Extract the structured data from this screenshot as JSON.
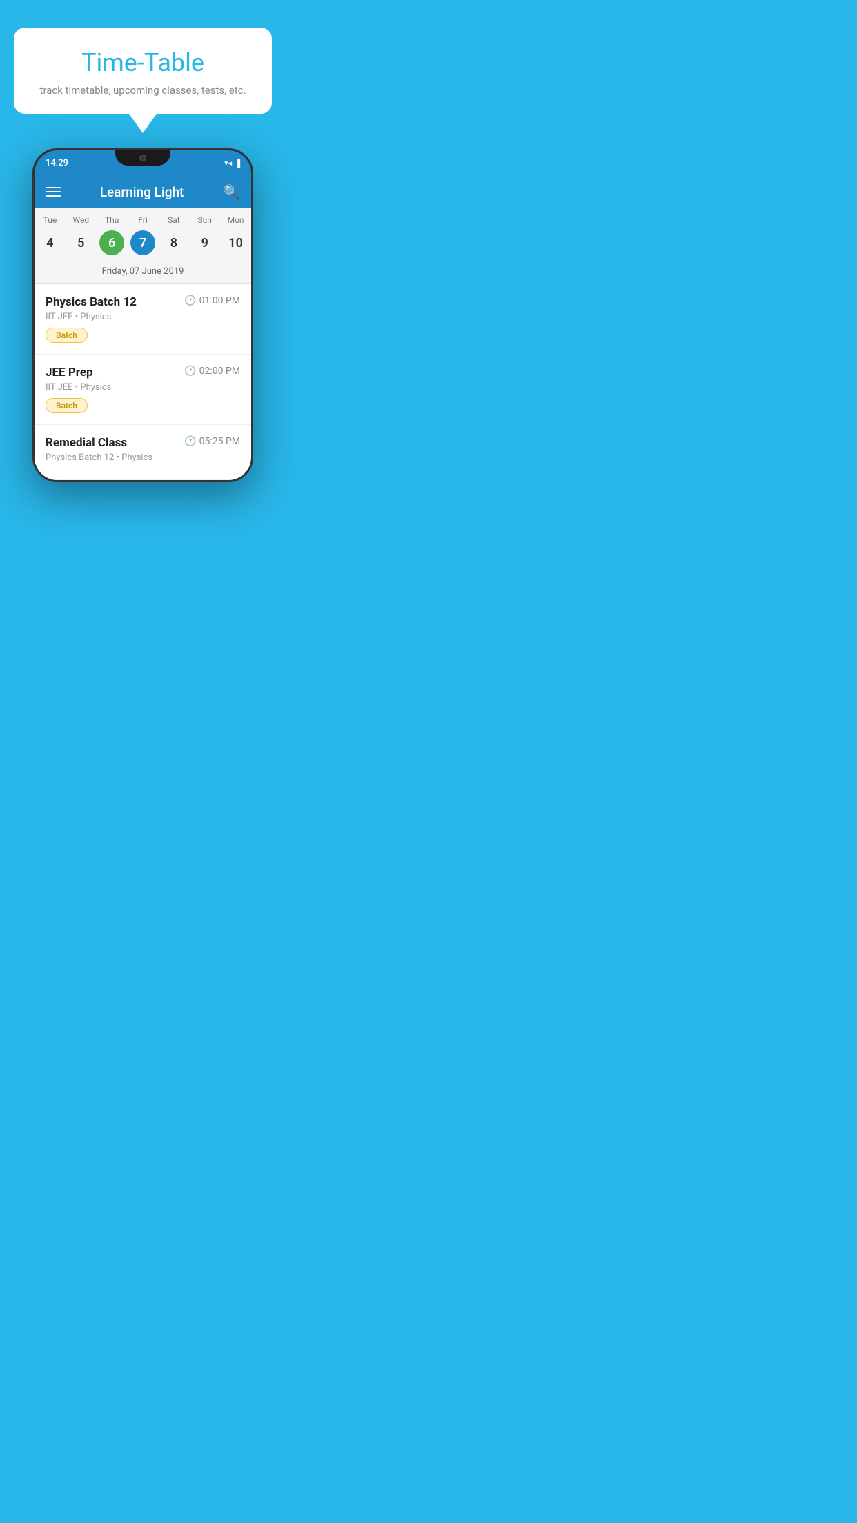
{
  "background_color": "#29B6E8",
  "bubble": {
    "title": "Time-Table",
    "subtitle": "track timetable, upcoming classes, tests, etc."
  },
  "phone": {
    "status_bar": {
      "time": "14:29",
      "icons": [
        "▼",
        "◀",
        "▐"
      ]
    },
    "header": {
      "title": "Learning Light",
      "hamburger_label": "menu",
      "search_label": "search"
    },
    "calendar": {
      "days": [
        "Tue",
        "Wed",
        "Thu",
        "Fri",
        "Sat",
        "Sun",
        "Mon"
      ],
      "dates": [
        "4",
        "5",
        "6",
        "7",
        "8",
        "9",
        "10"
      ],
      "today_index": 2,
      "selected_index": 3,
      "selected_label": "Friday, 07 June 2019"
    },
    "schedule": [
      {
        "name": "Physics Batch 12",
        "time": "01:00 PM",
        "sub": "IIT JEE • Physics",
        "badge": "Batch"
      },
      {
        "name": "JEE Prep",
        "time": "02:00 PM",
        "sub": "IIT JEE • Physics",
        "badge": "Batch"
      },
      {
        "name": "Remedial Class",
        "time": "05:25 PM",
        "sub": "Physics Batch 12 • Physics",
        "badge": null
      }
    ]
  }
}
